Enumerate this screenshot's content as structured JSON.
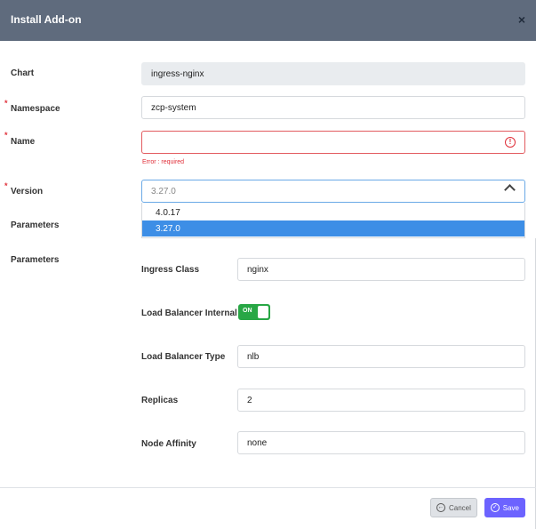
{
  "header": {
    "title": "Install Add-on",
    "close_icon": "close-icon"
  },
  "form": {
    "chart": {
      "label": "Chart",
      "value": "ingress-nginx"
    },
    "namespace": {
      "label": "Namespace",
      "value": "zcp-system",
      "required_mark": "*"
    },
    "name": {
      "label": "Name",
      "value": "",
      "required_mark": "*",
      "error": "Error : required",
      "error_icon": "!"
    },
    "version": {
      "label": "Version",
      "required_mark": "*",
      "selected": "3.27.0",
      "options": [
        "4.0.17",
        "3.27.0"
      ]
    },
    "parameters_label_1": "Parameters",
    "parameters_label_2": "Parameters",
    "parameters": {
      "ingress_class": {
        "label": "Ingress Class",
        "value": "nginx"
      },
      "lb_internal": {
        "label": "Load Balancer Internal",
        "toggle_text": "ON"
      },
      "lb_type": {
        "label": "Load Balancer Type",
        "value": "nlb"
      },
      "replicas": {
        "label": "Replicas",
        "value": "2"
      },
      "node_affinity": {
        "label": "Node Affinity",
        "value": "none"
      }
    }
  },
  "footer": {
    "cancel_label": "Cancel",
    "save_label": "Save",
    "cancel_icon": "←",
    "save_icon": "✓"
  },
  "colors": {
    "header_bg": "#5f6b7d",
    "error": "#e0303a",
    "toggle_on": "#28a745",
    "save": "#6c63ff",
    "selected_option": "#3d8ee6"
  }
}
